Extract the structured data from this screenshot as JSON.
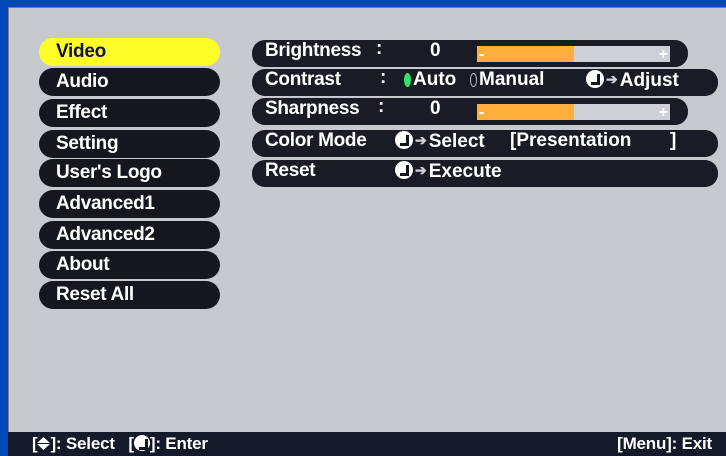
{
  "menu": {
    "items": [
      {
        "label": "Video",
        "active": true
      },
      {
        "label": "Audio",
        "active": false
      },
      {
        "label": "Effect",
        "active": false
      },
      {
        "label": "Setting",
        "active": false
      },
      {
        "label": "User's Logo",
        "active": false
      },
      {
        "label": "Advanced1",
        "active": false
      },
      {
        "label": "Advanced2",
        "active": false
      },
      {
        "label": "About",
        "active": false
      },
      {
        "label": "Reset All",
        "active": false
      }
    ]
  },
  "settings": {
    "brightness": {
      "label": "Brightness",
      "colon": ":",
      "value": "0",
      "level": 0.5,
      "minus": "-",
      "plus": "+"
    },
    "contrast": {
      "label": "Contrast",
      "colon": ":",
      "auto": "Auto",
      "manual": "Manual",
      "adjust": "Adjust",
      "selected": "Auto"
    },
    "sharpness": {
      "label": "Sharpness",
      "colon": ":",
      "value": "0",
      "level": 0.5,
      "minus": "-",
      "plus": "+"
    },
    "color_mode": {
      "label": "Color Mode",
      "action": "Select",
      "value": "[Presentation",
      "bracket": "]"
    },
    "reset": {
      "label": "Reset",
      "action": "Execute"
    }
  },
  "footer": {
    "select_open": "[",
    "select_close": "]: Select",
    "enter_open": "[",
    "enter_close": "]: Enter",
    "exit": "[Menu]: Exit"
  },
  "colors": {
    "active_menu": "#ffff28",
    "slider_fill": "#ffaf3c",
    "radio_on": "#2fe46a",
    "background_frame": "#0047b8"
  }
}
